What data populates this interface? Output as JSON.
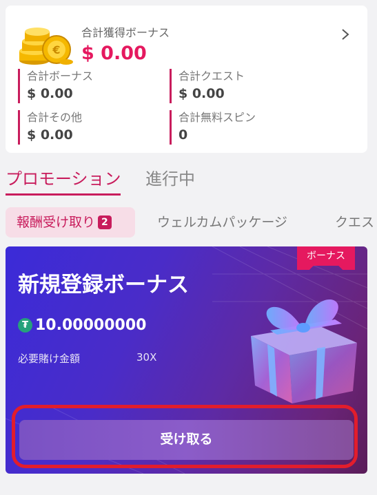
{
  "summary": {
    "total_label": "合計獲得ボーナス",
    "total_value": "$ 0.00",
    "stats": [
      {
        "label": "合計ボーナス",
        "value": "$ 0.00"
      },
      {
        "label": "合計クエスト",
        "value": "$ 0.00"
      },
      {
        "label": "合計その他",
        "value": "$ 0.00"
      },
      {
        "label": "合計無料スピン",
        "value": "0"
      }
    ]
  },
  "main_tabs": [
    {
      "label": "プロモーション",
      "active": true
    },
    {
      "label": "進行中",
      "active": false
    }
  ],
  "sub_tabs": [
    {
      "label": "報酬受け取り",
      "badge": "2",
      "active": true
    },
    {
      "label": "ウェルカムパッケージ",
      "active": false
    },
    {
      "label": "クエス",
      "active": false
    }
  ],
  "bonus_card": {
    "tag": "ボーナス",
    "title": "新規登録ボーナス",
    "currency_icon": "tether-icon",
    "amount": "10.00000000",
    "wager_label": "必要賭け金額",
    "wager_value": "30X",
    "claim_label": "受け取る"
  },
  "colors": {
    "accent": "#c81c5c",
    "value_red": "#e5195f",
    "highlight": "#e21d2c",
    "tether": "#26a17b"
  }
}
